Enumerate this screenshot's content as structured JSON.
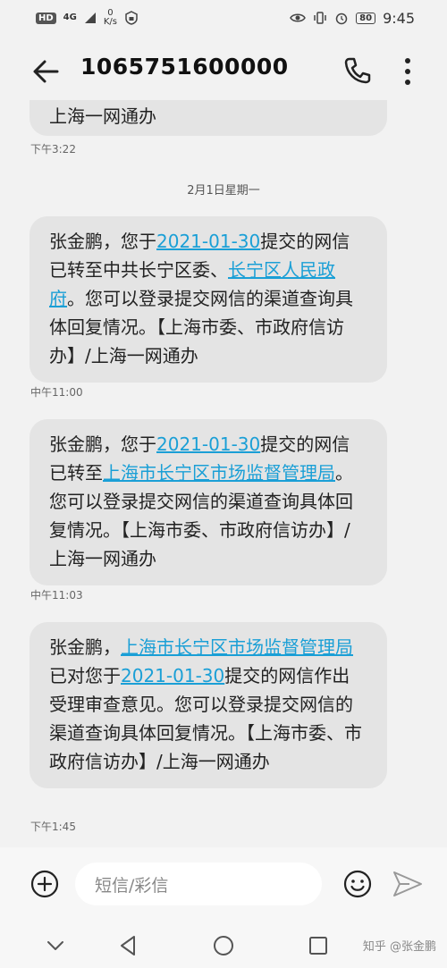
{
  "status_bar": {
    "network_badge": "HD",
    "signal_label": "4G",
    "speed_value": "0",
    "speed_unit": "K/s",
    "battery": "80",
    "time": "9:45"
  },
  "header": {
    "title": "1065751600000"
  },
  "thread": {
    "partial_message": "上海一网通办",
    "partial_time": "下午3:22",
    "date_separator": "2月1日星期一",
    "messages": [
      {
        "parts": [
          "张金鹏，您于",
          "2021-01-30",
          "提交的网信已转至中共长宁区委、",
          "长宁区人民政府",
          "。您可以登录提交网信的渠道查询具体回复情况。【上海市委、市政府信访办】/上海一网通办"
        ],
        "time": "中午11:00"
      },
      {
        "parts": [
          "张金鹏，您于",
          "2021-01-30",
          "提交的网信已转至",
          "上海市长宁区市场监督管理局",
          "。您可以登录提交网信的渠道查询具体回复情况。【上海市委、市政府信访办】/上海一网通办"
        ],
        "time": "中午11:03"
      },
      {
        "parts": [
          "张金鹏，",
          "上海市长宁区市场监督管理局",
          "已对您于",
          "2021-01-30",
          "提交的网信作出受理审查意见。您可以登录提交网信的渠道查询具体回复情况。【上海市委、市政府信访办】/上海一网通办"
        ],
        "time": "下午1:45"
      }
    ]
  },
  "composer": {
    "placeholder": "短信/彩信"
  },
  "watermark": "知乎 @张金鹏",
  "icons": {
    "back": "back-arrow-icon",
    "phone": "phone-icon",
    "more": "more-vertical-icon",
    "plus": "plus-circle-icon",
    "emoji": "emoji-icon",
    "send": "send-icon"
  },
  "colors": {
    "link": "#1a9fd6",
    "bubble": "#e4e4e4",
    "background": "#f2f2f2"
  }
}
